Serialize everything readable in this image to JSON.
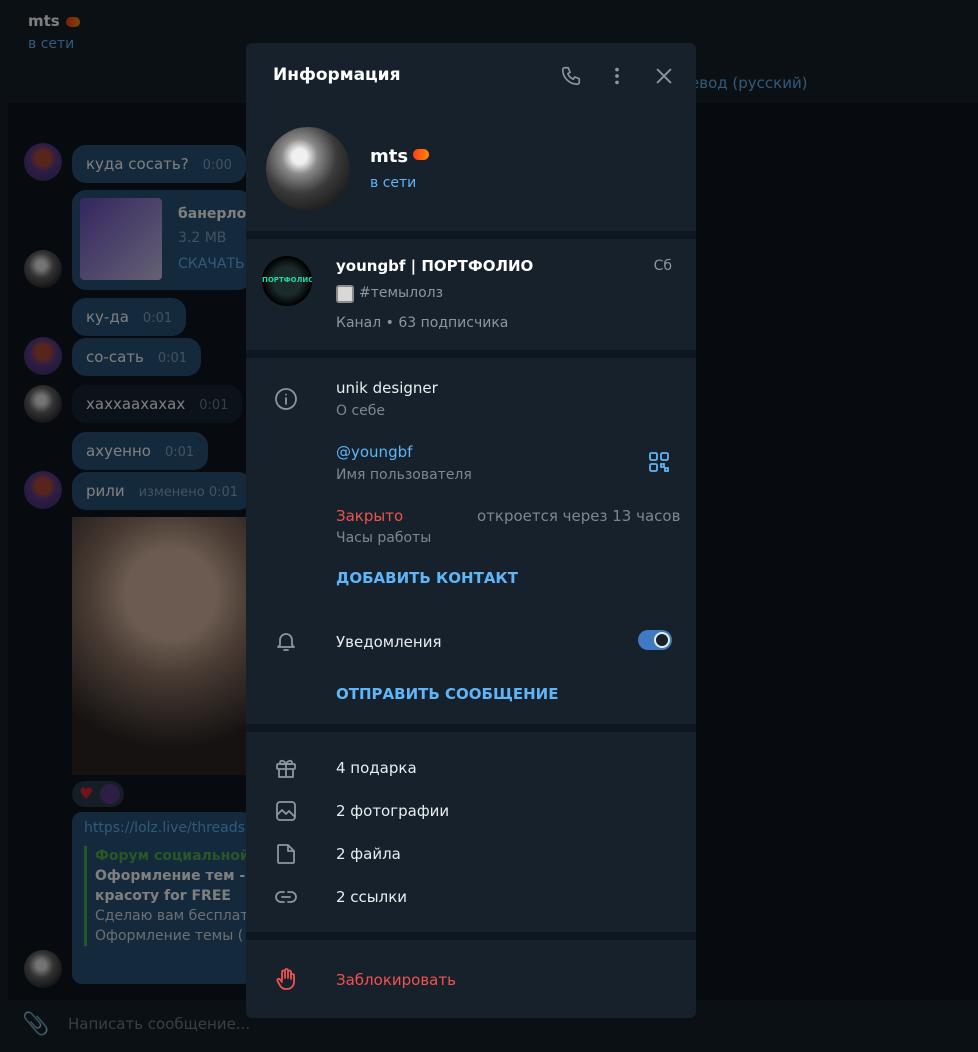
{
  "background": {
    "chat_title": "mts",
    "chat_status": "в сети",
    "translate_bar": "евод (русский)",
    "messages": [
      {
        "text": "куда сосать?",
        "time": "0:00"
      },
      {
        "text": "ку-да",
        "time": "0:01"
      },
      {
        "text": "со-сать",
        "time": "0:01"
      },
      {
        "text": "хаххаахахах",
        "time": "0:01"
      },
      {
        "text": "ахуенно",
        "time": "0:01"
      },
      {
        "text": "рили",
        "time": "изменено 0:01"
      }
    ],
    "file": {
      "name": "банерлол",
      "size": "3.2 MB",
      "download": "СКАЧАТЬ"
    },
    "link_message": {
      "url": "https://lolz.live/threads",
      "site": "Форум социальной",
      "title_line1": "Оформление тем - А",
      "title_line2": "красоту for FREE",
      "desc_line1": "Сделаю вам бесплат",
      "desc_line2": " Оформление темы ("
    },
    "input_placeholder": "Написать сообщение..."
  },
  "panel": {
    "title": "Информация",
    "profile": {
      "name": "mts",
      "status": "в сети"
    },
    "channel": {
      "title": "youngbf | ПОРТФОЛИО",
      "date": "Сб",
      "preview": "#темылолз",
      "meta": "Канал • 63 подписчика",
      "avatar_label": "ПОРТФОЛИО"
    },
    "bio": {
      "value": "unik designer",
      "label": "О себе"
    },
    "username": {
      "value": "@youngbf",
      "label": "Имя пользователя"
    },
    "hours": {
      "status": "Закрыто",
      "opens": "откроется через 13 часов",
      "label": "Часы работы"
    },
    "add_contact": "ДОБАВИТЬ КОНТАКТ",
    "notifications": {
      "label": "Уведомления",
      "enabled": true
    },
    "send_message": "ОТПРАВИТЬ СООБЩЕНИЕ",
    "media": {
      "gifts": "4 подарка",
      "photos": "2 фотографии",
      "files": "2 файла",
      "links": "2 ссылки"
    },
    "block": "Заблокировать"
  },
  "colors": {
    "accent": "#5eb5f7",
    "danger": "#ef5350",
    "panel_bg": "#17212b"
  }
}
